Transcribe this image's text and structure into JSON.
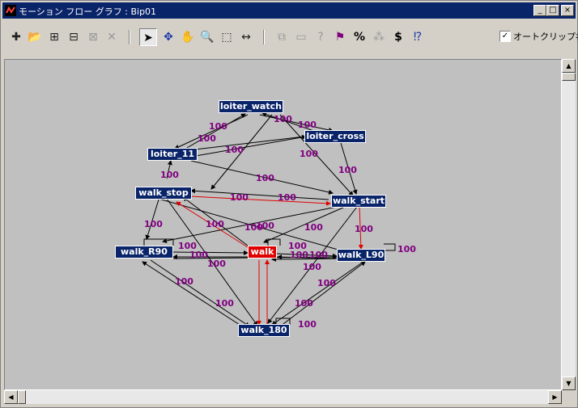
{
  "window": {
    "title": "モーション フロー グラフ : Bip01"
  },
  "titlebar_buttons": {
    "minimize": "_",
    "maximize": "□",
    "close": "×"
  },
  "toolbar": {
    "tools": [
      {
        "icon": "new-transition-icon",
        "glyph": "✚"
      },
      {
        "icon": "open-folder-icon",
        "glyph": "📂"
      },
      {
        "icon": "insert-script-icon",
        "glyph": "⊞"
      },
      {
        "icon": "script-step-icon",
        "glyph": "⊟"
      },
      {
        "icon": "random-icon",
        "glyph": "⊠"
      },
      {
        "icon": "delete-icon",
        "glyph": "✕"
      },
      {
        "icon": "select-arrow-icon",
        "glyph": "➤"
      },
      {
        "icon": "move-icon",
        "glyph": "✥"
      },
      {
        "icon": "pan-hand-icon",
        "glyph": "✋"
      },
      {
        "icon": "zoom-icon",
        "glyph": "🔍"
      },
      {
        "icon": "zoom-region-icon",
        "glyph": "⬚"
      },
      {
        "icon": "fit-width-icon",
        "glyph": "↔"
      },
      {
        "icon": "copy-icon",
        "glyph": "⧉"
      },
      {
        "icon": "rectangle-icon",
        "glyph": "▭"
      },
      {
        "icon": "question-icon",
        "glyph": "?"
      },
      {
        "icon": "flag-pointer-icon",
        "glyph": "⚑"
      },
      {
        "icon": "percent-icon",
        "glyph": "%"
      },
      {
        "icon": "dots-icon",
        "glyph": "⁂"
      },
      {
        "icon": "dollar-icon",
        "glyph": "$"
      },
      {
        "icon": "script-question-icon",
        "glyph": "⁉"
      }
    ],
    "auto_clip": {
      "label": "オートクリップ名",
      "checked": true,
      "mark": "✓"
    }
  },
  "graph": {
    "node_color": "#0a246a",
    "selected_color": "#e00000",
    "weight_color": "#800080",
    "nodes": [
      {
        "id": "loiter_watch",
        "label": "loiter_watch",
        "selected": false
      },
      {
        "id": "loiter_cross",
        "label": "loiter_cross",
        "selected": false
      },
      {
        "id": "loiter_11",
        "label": "loiter_11",
        "selected": false
      },
      {
        "id": "walk_stop",
        "label": "walk_stop",
        "selected": false
      },
      {
        "id": "walk_start",
        "label": "walk_start",
        "selected": false
      },
      {
        "id": "walk_R90",
        "label": "walk_R90",
        "selected": false
      },
      {
        "id": "walk",
        "label": "walk",
        "selected": true
      },
      {
        "id": "walk_L90",
        "label": "walk_L90",
        "selected": false
      },
      {
        "id": "walk_180",
        "label": "walk_180",
        "selected": false
      }
    ],
    "weight_label": "100"
  }
}
